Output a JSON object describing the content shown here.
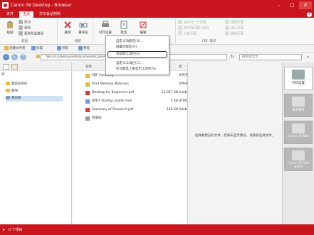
{
  "window": {
    "title": "Canon iW Desktop - Browser",
    "controls": {
      "minimize": "–",
      "maximize": "□",
      "close": "✕"
    }
  },
  "ribbon": {
    "tabs": [
      "文件",
      "主页",
      "打印会话材料"
    ],
    "help": "?",
    "groups": {
      "clipboard": {
        "label": "剪贴",
        "paste": "粘贴",
        "cut": "剪切",
        "copy": "复制",
        "copy_path": "复制所选路径"
      },
      "organize": {
        "label": "组织",
        "delete": "删除",
        "rename": "重命名",
        "new_folder": "新建文件夹"
      },
      "print": {
        "print_settings": "打印设置",
        "annotate": "批注",
        "edit": "编辑"
      },
      "pdf": {
        "label": "PDF 操作",
        "merge_to_one_page": "合并为一个页面",
        "merge_in_page_order": "在所选页面上合并",
        "separate_pages": "分离页面",
        "extract_pages": "提取页面",
        "insert_pages": "插入页面",
        "delete_pages": "删除页面"
      }
    }
  },
  "context_menu": {
    "items": [
      "自定义功能区(U)...",
      "隐藏功能区(R)",
      "添加到工具栏(A)",
      "自定义工具栏(C)...",
      "在功能区上部显示工具栏(S)"
    ],
    "highlighted_index": 2
  },
  "quickbar": {
    "items": [
      "创建文件夹",
      "扫描",
      "导航",
      "预览"
    ]
  },
  "address": {
    "path": "file:///C/Users/user/Documents/Canon iW Desktop Library",
    "search_placeholder": "搜索库显示"
  },
  "left_panel": {
    "label": "库",
    "tree": [
      "我的任务栏",
      "图书",
      "我的库"
    ],
    "selected": 2
  },
  "file_list": {
    "columns": {
      "name": "名称",
      "size": "大小",
      "type": "类"
    },
    "rows": [
      {
        "icon": "folder-icon",
        "name": "PDF Handling",
        "size": "",
        "type": "文件夹"
      },
      {
        "icon": "folder-icon",
        "name": "Print Meeting Materials",
        "size": "",
        "type": "文件夹"
      },
      {
        "icon": "pdf-icon",
        "name": "Desktop for Beginners.pdf",
        "size": "12,057 KB",
        "type": "Adobe"
      },
      {
        "icon": "html-icon",
        "name": "iWDT Startup Guide.html",
        "size": "4 KB",
        "type": "HTML"
      },
      {
        "icon": "pdf-icon",
        "name": "Summary of Research.pdf",
        "size": "158 KB",
        "type": "Adobe"
      },
      {
        "icon": "trash-icon",
        "name": "回收站",
        "size": "",
        "type": ""
      }
    ]
  },
  "preview": {
    "message": "选择要预览的文件。结果未显示预览，请重新选择文件。"
  },
  "output_bar": {
    "buttons": [
      "打印设置",
      "电子邮件",
      "Canon iR-ADV",
      "Canon iR-ADV (FAX)"
    ]
  },
  "status": {
    "text": "0 个项目"
  },
  "colors": {
    "brand": "#c9161e",
    "selection": "#cde3f5"
  }
}
